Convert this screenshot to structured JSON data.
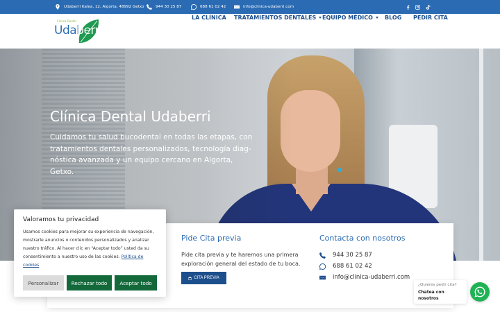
{
  "topbar": {
    "address": "Udaberri Kalea, 12, Algorta, 48992 Getxo",
    "phone": "944 30 25 87",
    "whatsapp": "688 61 02 42",
    "email": "info@clinica-udaberri.com",
    "social": [
      "facebook-icon",
      "instagram-icon",
      "tiktok-icon"
    ]
  },
  "logo": {
    "small_text": "Clínica Dental",
    "name": "Udaberri"
  },
  "nav": {
    "items": [
      {
        "label": "LA CLÍNICA",
        "has_dropdown": false
      },
      {
        "label": "TRATAMIENTOS DENTALES",
        "has_dropdown": true
      },
      {
        "label": "EQUIPO MÉDICO",
        "has_dropdown": true
      },
      {
        "label": "BLOG",
        "has_dropdown": false
      },
      {
        "label": "PEDIR CITA",
        "has_dropdown": false
      }
    ]
  },
  "hero": {
    "title": "Clínica Dental Udaberri",
    "text": "Cuidamos tu salud bucodental en todas las etapas, con tratamientos dentales personalizados, tecnología diag-nóstica avanzada y un equipo cercano en Algorta, Getxo."
  },
  "cita": {
    "title": "Pide Cita previa",
    "text": "Pide cita previa y te haremos una primera exploración general del estado de tu boca.",
    "button": "CITA PREVIA"
  },
  "contacto": {
    "title": "Contacta con nosotros",
    "phone": "944 30 25 87",
    "whatsapp": "688 61 02 42",
    "email": "info@clinica-udaberri.com"
  },
  "cookies": {
    "title": "Valoramos tu privacidad",
    "text": "Usamos cookies para mejorar su experiencia de navegación, mostrarle anuncios o contenidos personalizados y analizar nuestro tráfico. Al hacer clic en “Aceptar todo” usted da su consentimiento a nuestro uso de las cookies.",
    "link": "Política de cookies",
    "btn_customize": "Personalizar",
    "btn_reject": "Rechazar todo",
    "btn_accept": "Aceptar todo"
  },
  "chat": {
    "question": "¿Quieres pedir cita?",
    "cta": "Chatea con nosotros"
  },
  "colors": {
    "brand_blue": "#2a6bb3",
    "nav_blue": "#1d4f8c",
    "cookie_green": "#14693b",
    "whatsapp_green": "#1fb355",
    "leaf_green": "#1f9a50"
  }
}
